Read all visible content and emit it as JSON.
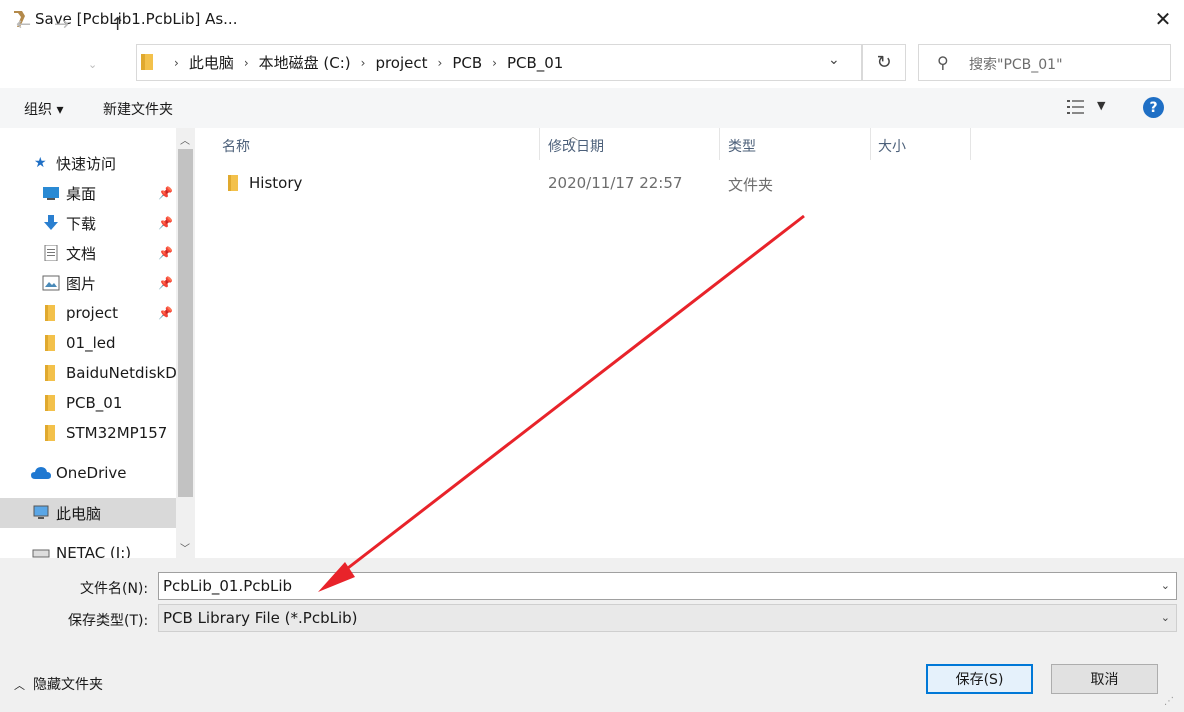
{
  "window": {
    "title": "Save [PcbLib1.PcbLib] As..."
  },
  "address": {
    "crumbs": [
      "此电脑",
      "本地磁盘 (C:)",
      "project",
      "PCB",
      "PCB_01"
    ]
  },
  "search": {
    "placeholder": "搜索\"PCB_01\""
  },
  "toolbar": {
    "organize": "组织 ▾",
    "new_folder": "新建文件夹"
  },
  "nav": {
    "quick_access": "快速访问",
    "items": [
      {
        "label": "桌面",
        "icon": "desktop-icon",
        "pinned": true
      },
      {
        "label": "下载",
        "icon": "download-icon",
        "pinned": true
      },
      {
        "label": "文档",
        "icon": "document-icon",
        "pinned": true
      },
      {
        "label": "图片",
        "icon": "picture-icon",
        "pinned": true
      },
      {
        "label": "project",
        "icon": "folder-icon",
        "pinned": true
      },
      {
        "label": "01_led",
        "icon": "folder-icon",
        "pinned": false
      },
      {
        "label": "BaiduNetdiskDo",
        "icon": "folder-icon",
        "pinned": false
      },
      {
        "label": "PCB_01",
        "icon": "folder-icon",
        "pinned": false
      },
      {
        "label": "STM32MP157",
        "icon": "folder-icon",
        "pinned": false
      }
    ],
    "onedrive": "OneDrive",
    "this_pc": "此电脑",
    "netac": "NETAC (J:)"
  },
  "columns": {
    "name": "名称",
    "date": "修改日期",
    "type": "类型",
    "size": "大小"
  },
  "files": [
    {
      "name": "History",
      "date": "2020/11/17 22:57",
      "type": "文件夹"
    }
  ],
  "form": {
    "filename_label": "文件名(N):",
    "filename_value": "PcbLib_01.PcbLib",
    "filetype_label": "保存类型(T):",
    "filetype_value": "PCB Library File (*.PcbLib)"
  },
  "footer": {
    "hide_folders": "隐藏文件夹",
    "save": "保存(S)",
    "cancel": "取消"
  },
  "colors": {
    "accent": "#0078d7",
    "annotation_arrow": "#e8232a",
    "folder": "#f3c14b"
  }
}
